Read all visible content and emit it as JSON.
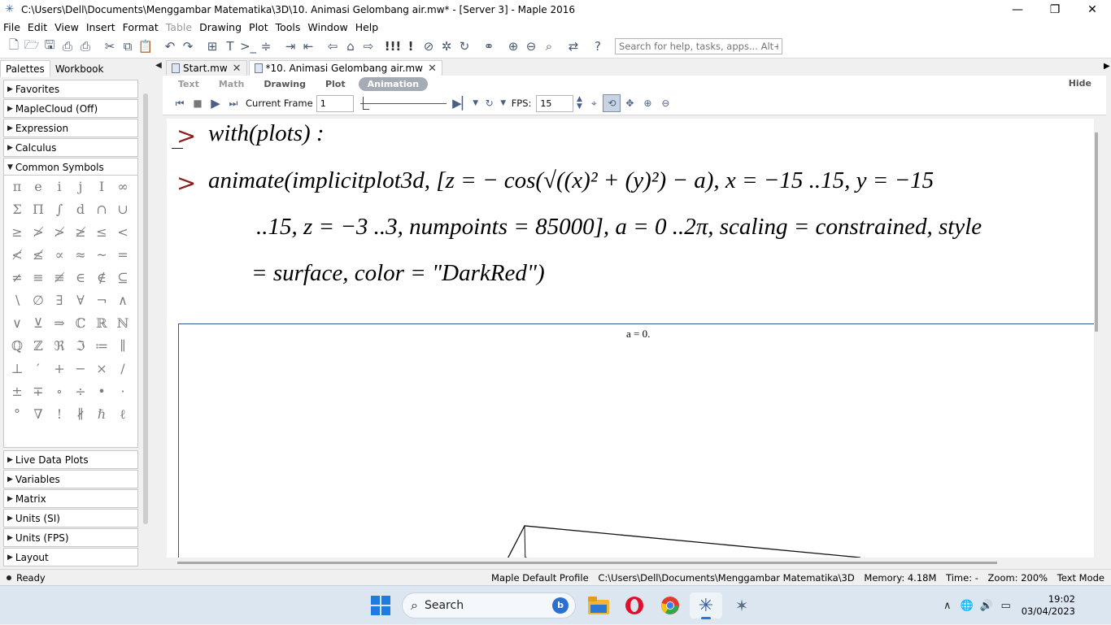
{
  "window": {
    "title": "C:\\Users\\Dell\\Documents\\Menggambar Matematika\\3D\\10. Animasi Gelombang air.mw* - [Server 3] - Maple 2016",
    "minimize": "—",
    "maximize": "❐",
    "close": "✕"
  },
  "menubar": {
    "items": [
      "File",
      "Edit",
      "View",
      "Insert",
      "Format",
      "Table",
      "Drawing",
      "Plot",
      "Tools",
      "Window",
      "Help"
    ]
  },
  "toolbar": {
    "search_placeholder": "Search for help, tasks, apps... Alt+S"
  },
  "palette_panel": {
    "tabs": [
      "Palettes",
      "Workbook"
    ],
    "sections_top": [
      "Favorites",
      "MapleCloud (Off)",
      "Expression",
      "Calculus",
      "Common Symbols"
    ],
    "sections_bottom": [
      "Live Data Plots",
      "Variables",
      "Matrix",
      "Units (SI)",
      "Units (FPS)",
      "Layout"
    ],
    "symbols": [
      "π",
      "e",
      "i",
      "j",
      "I",
      "∞",
      "Σ",
      "Π",
      "∫",
      "d",
      "∩",
      "∪",
      "≥",
      "≯",
      "≯",
      "≱",
      "≤",
      "<",
      "≮",
      "≰",
      "∝",
      "≈",
      "~",
      "=",
      "≠",
      "≡",
      "≢",
      "∈",
      "∉",
      "⊆",
      "∖",
      "∅",
      "∃",
      "∀",
      "¬",
      "∧",
      "∨",
      "⊻",
      "⇒",
      "ℂ",
      "ℝ",
      "ℕ",
      "ℚ",
      "ℤ",
      "ℜ",
      "ℑ",
      "≔",
      "∥",
      "⊥",
      "′",
      "+",
      "−",
      "×",
      "/",
      "±",
      "∓",
      "∘",
      "÷",
      "•",
      "·",
      "°",
      "∇",
      "!",
      "∦",
      "ℏ",
      "ℓ"
    ]
  },
  "document": {
    "tabs": [
      {
        "label": "Start.mw",
        "close": "✕"
      },
      {
        "label": "*10. Animasi Gelombang air.mw",
        "close": "✕"
      }
    ],
    "modes": [
      "Text",
      "Math",
      "Drawing",
      "Plot",
      "Animation"
    ],
    "hide_label": "Hide",
    "animation": {
      "current_frame_label": "Current Frame",
      "current_frame": "1",
      "fps_label": "FPS:",
      "fps": "15"
    },
    "input_line1": {
      "prompt": ">",
      "text": "with(plots) :"
    },
    "input_line2": {
      "prompt": ">",
      "row1": "animate(implicitplot3d, [z = − cos(√((x)² + (y)²) − a), x = −15 ..15, y = −15",
      "row2": "..15, z = −3 ..3, numpoints = 85000], a = 0 ..2π, scaling = constrained, style",
      "row3": "= surface, color = \"DarkRed\")"
    },
    "plot_label": "a = 0."
  },
  "statusbar": {
    "status": "Ready",
    "profile": "Maple Default Profile",
    "path": "C:\\Users\\Dell\\Documents\\Menggambar Matematika\\3D",
    "memory": "Memory: 4.18M",
    "time": "Time: -",
    "zoom": "Zoom: 200%",
    "mode": "Text Mode"
  },
  "taskbar": {
    "search_label": "Search",
    "time": "19:02",
    "date": "03/04/2023"
  },
  "colors": {
    "prompt_red": "#8a1c1c",
    "plot_border": "#2e5c9a",
    "surface_darkred": "#8b0000"
  }
}
